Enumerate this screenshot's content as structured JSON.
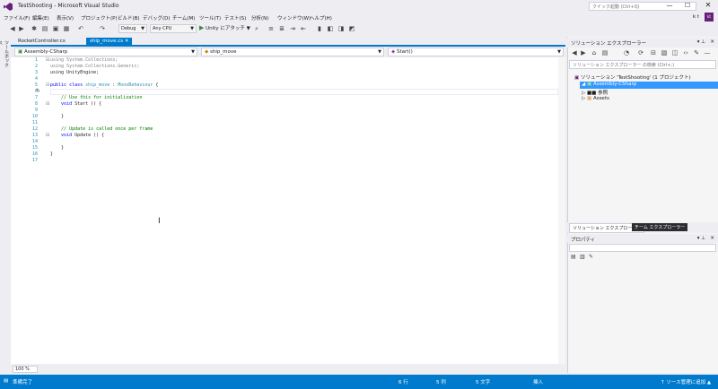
{
  "window": {
    "title": "TestShooting - Microsoft Visual Studio",
    "quick_launch_placeholder": "クイック起動 (Ctrl+Q)",
    "user": "k t",
    "user_initials": "kt"
  },
  "menu": [
    "ファイル(F)",
    "編集(E)",
    "表示(V)",
    "プロジェクト(P)",
    "ビルド(B)",
    "デバッグ(D)",
    "チーム(M)",
    "ツール(T)",
    "テスト(S)",
    "分析(N)",
    "ウィンドウ(W)",
    "ヘルプ(H)"
  ],
  "toolbar": {
    "config": "Debug",
    "platform": "Any CPU",
    "start_label": "Unity にアタッチ"
  },
  "left_strip": {
    "toolbox": "ツールボックス"
  },
  "tabs": [
    {
      "label": "RocketController.cs"
    },
    {
      "label": "ship_move.cs"
    }
  ],
  "nav": {
    "project": "Assembly-CSharp",
    "class": "ship_move",
    "member": "Start()"
  },
  "editor": {
    "line_numbers": [
      "1",
      "2",
      "3",
      "4",
      "5",
      "6",
      "7",
      "8",
      "9",
      "10",
      "11",
      "12",
      "13",
      "14",
      "15",
      "16",
      "17"
    ],
    "lines": [
      {
        "parts": [
          {
            "t": "using System.Collections;",
            "c": "dim"
          }
        ]
      },
      {
        "parts": [
          {
            "t": "using System.Collections.Generic;",
            "c": "dim"
          }
        ]
      },
      {
        "parts": [
          {
            "t": "using UnityEngine;",
            "c": ""
          }
        ]
      },
      {
        "parts": [
          {
            "t": "",
            "c": ""
          }
        ]
      },
      {
        "parts": [
          {
            "t": "public class ",
            "c": "kw"
          },
          {
            "t": "ship_move",
            "c": "ty"
          },
          {
            "t": " : ",
            "c": ""
          },
          {
            "t": "MonoBehaviour",
            "c": "ty"
          },
          {
            "t": " {",
            "c": ""
          }
        ]
      },
      {
        "parts": [
          {
            "t": "",
            "c": ""
          }
        ]
      },
      {
        "parts": [
          {
            "t": "    // Use this for initialization",
            "c": "cm"
          }
        ]
      },
      {
        "parts": [
          {
            "t": "    void ",
            "c": "kw"
          },
          {
            "t": "Start () {",
            "c": ""
          }
        ]
      },
      {
        "parts": [
          {
            "t": "",
            "c": ""
          }
        ]
      },
      {
        "parts": [
          {
            "t": "    }",
            "c": ""
          }
        ]
      },
      {
        "parts": [
          {
            "t": "",
            "c": ""
          }
        ]
      },
      {
        "parts": [
          {
            "t": "    // Update is called once per frame",
            "c": "cm"
          }
        ]
      },
      {
        "parts": [
          {
            "t": "    void ",
            "c": "kw"
          },
          {
            "t": "Update () {",
            "c": ""
          }
        ]
      },
      {
        "parts": [
          {
            "t": "",
            "c": ""
          }
        ]
      },
      {
        "parts": [
          {
            "t": "    }",
            "c": ""
          }
        ]
      },
      {
        "parts": [
          {
            "t": "}",
            "c": ""
          }
        ]
      },
      {
        "parts": [
          {
            "t": "",
            "c": ""
          }
        ]
      }
    ],
    "zoom": "100 %"
  },
  "solution_explorer": {
    "title": "ソリューション エクスプローラー",
    "search_placeholder": "ソリューション エクスプローラー の検索 (Ctrl+;)",
    "solution": "ソリューション 'TestShooting' (1 プロジェクト)",
    "project": "Assembly-CSharp",
    "references": "参照",
    "assets": "Assets",
    "tab_se": "ソリューション エクスプローラー",
    "tab_team": "チーム エクスプローラー"
  },
  "properties": {
    "title": "プロパティ"
  },
  "status": {
    "ready": "準備完了",
    "line": "6 行",
    "col": "5 列",
    "chars": "5 文字",
    "ins": "挿入",
    "source_control": "↑ ソース管理に追加 ▲"
  }
}
